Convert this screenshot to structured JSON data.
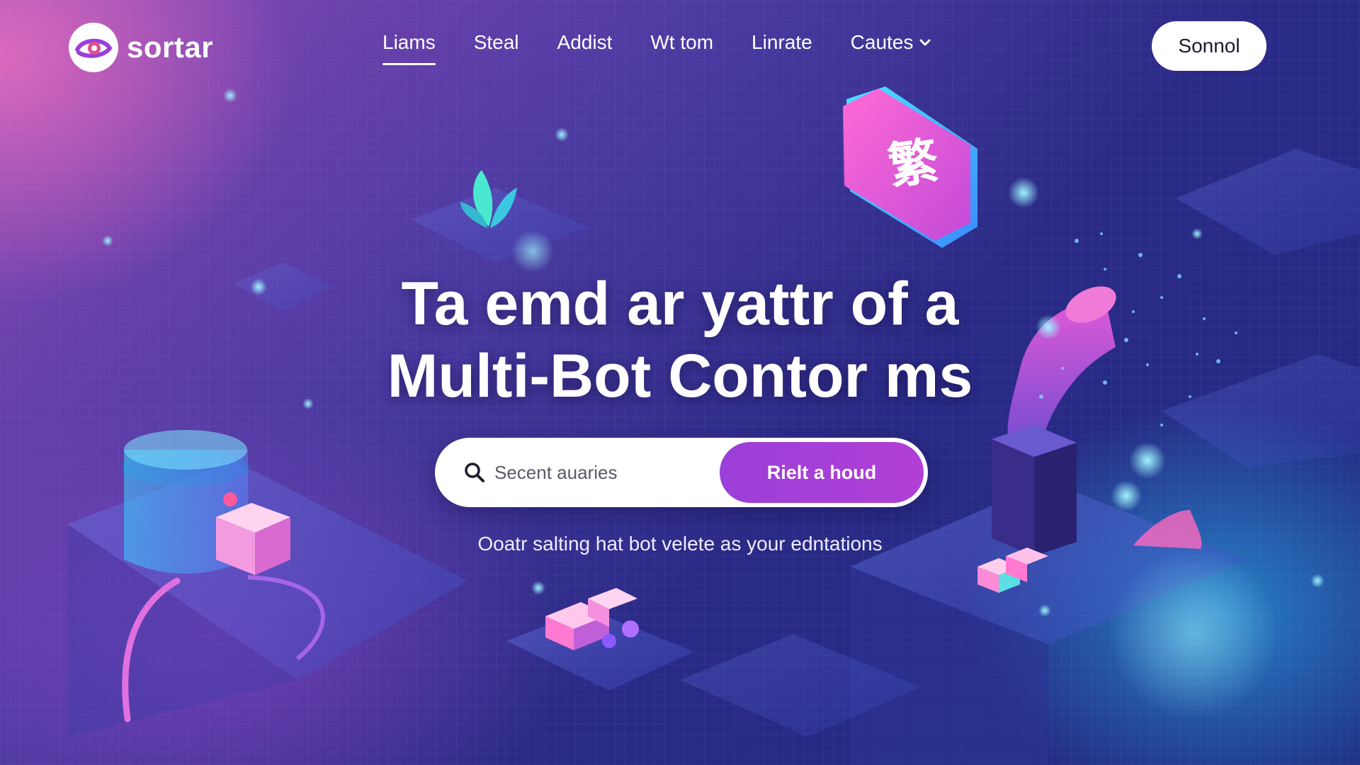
{
  "brand": {
    "name": "sortar",
    "logo_icon": "eye-swirl-icon"
  },
  "nav": {
    "items": [
      {
        "label": "Liams",
        "active": true
      },
      {
        "label": "Steal",
        "active": false
      },
      {
        "label": "Addist",
        "active": false
      },
      {
        "label": "Wt tom",
        "active": false
      },
      {
        "label": "Linrate",
        "active": false
      },
      {
        "label": "Cautes",
        "active": false,
        "icon": "chevron-down-icon"
      }
    ],
    "cta_label": "Sonnol"
  },
  "hero": {
    "title_line1": "Ta emd ar yattr of a",
    "title_line2": "Multi-Bot Contor ms",
    "search_placeholder": "Secent auaries",
    "search_button_label": "Rielt a houd",
    "subtitle": "Ooatr salting hat bot velete as your edntations"
  },
  "decor": {
    "badge_glyph": "繁",
    "colors": {
      "accent_purple": "#9a3fd8",
      "cyan": "#39d4ff",
      "pink": "#f06ad0"
    }
  }
}
